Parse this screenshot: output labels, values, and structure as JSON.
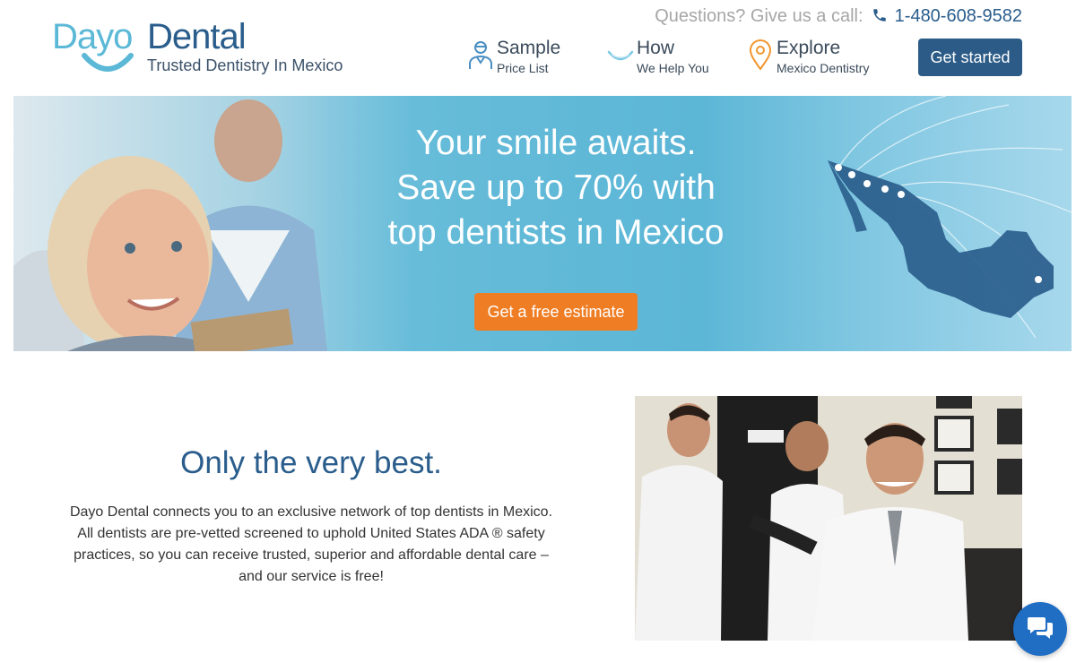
{
  "header": {
    "logo": {
      "brand_part1": "Dayo",
      "brand_part2": "Dental",
      "tagline": "Trusted Dentistry In Mexico"
    },
    "contact": {
      "question": "Questions? Give us a call:",
      "phone": "1-480-608-9582",
      "icon": "phone-icon"
    },
    "nav": [
      {
        "title": "Sample",
        "subtitle": "Price List",
        "icon": "dentist-icon"
      },
      {
        "title": "How",
        "subtitle": "We Help You",
        "icon": "smile-icon"
      },
      {
        "title": "Explore",
        "subtitle": "Mexico Dentistry",
        "icon": "map-pin-icon"
      }
    ],
    "cta_label": "Get started"
  },
  "hero": {
    "headline_lines": [
      "Your smile awaits.",
      "Save up to 70% with",
      "top dentists in Mexico"
    ],
    "button_label": "Get a free estimate"
  },
  "section": {
    "title": "Only the very best.",
    "body_lines": [
      "Dayo Dental connects you to an exclusive network of top dentists in Mexico.",
      "All dentists are pre-vetted screened to uphold United States ADA ® safety",
      "practices, so you can receive trusted, superior and affordable dental care –",
      "and our service is free!"
    ]
  },
  "chat": {
    "icon": "chat-icon"
  },
  "colors": {
    "brand_light": "#5bb8d6",
    "brand_dark": "#2a5d8c",
    "button_blue": "#2b5b86",
    "button_orange": "#ef7d23",
    "hero_blue": "#5cb6d6",
    "chat_blue": "#1f6ec4"
  }
}
